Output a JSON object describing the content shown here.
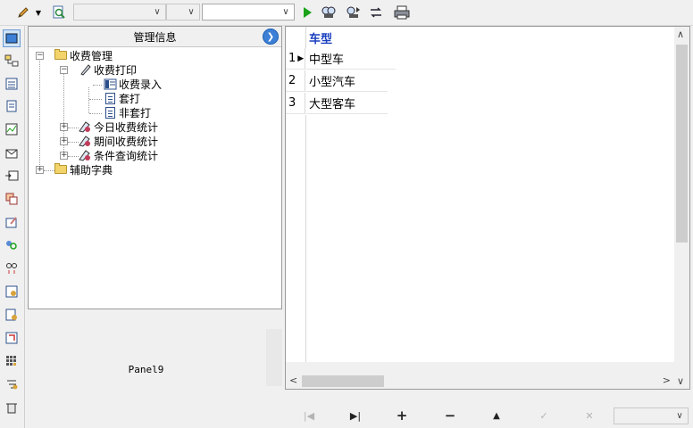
{
  "toolbar": {
    "icons": [
      "pencil-dropdown-icon",
      "search-doc-icon",
      "run-icon",
      "find-icon",
      "find-next-icon",
      "refresh-icon",
      "print-icon"
    ],
    "run_color": "#1aa31a"
  },
  "sidebar": {
    "icons": [
      "form-view-icon",
      "structure-icon",
      "list-icon",
      "document-icon",
      "chart-icon",
      "inbox-icon",
      "export-icon",
      "copy-icon",
      "edit-form-icon",
      "user-search-icon",
      "relations-icon",
      "table-settings-icon",
      "report-icon",
      "import-icon",
      "grid-icon",
      "hierarchy-icon",
      "trash-icon"
    ]
  },
  "tree": {
    "header": "管理信息",
    "nodes": [
      {
        "label": "收费管理"
      },
      {
        "label": "收费打印"
      },
      {
        "label": "收费录入"
      },
      {
        "label": "套打"
      },
      {
        "label": "非套打"
      },
      {
        "label": "今日收费统计"
      },
      {
        "label": "期间收费统计"
      },
      {
        "label": "条件查询统计"
      },
      {
        "label": "辅助字典"
      }
    ]
  },
  "panel9": {
    "caption": "Panel9"
  },
  "grid": {
    "column": "车型",
    "rows": [
      {
        "no": "1",
        "value": "中型车"
      },
      {
        "no": "2",
        "value": "小型汽车"
      },
      {
        "no": "3",
        "value": "大型客车"
      }
    ],
    "current_row": "▶"
  },
  "navigator": {
    "first": "|◀",
    "last": "▶|",
    "insert": "+",
    "delete": "−",
    "edit": "▲",
    "post": "✓",
    "cancel": "✕"
  },
  "colors": {
    "accent": "#3c7fd6",
    "header_text": "#1a3fbf"
  }
}
